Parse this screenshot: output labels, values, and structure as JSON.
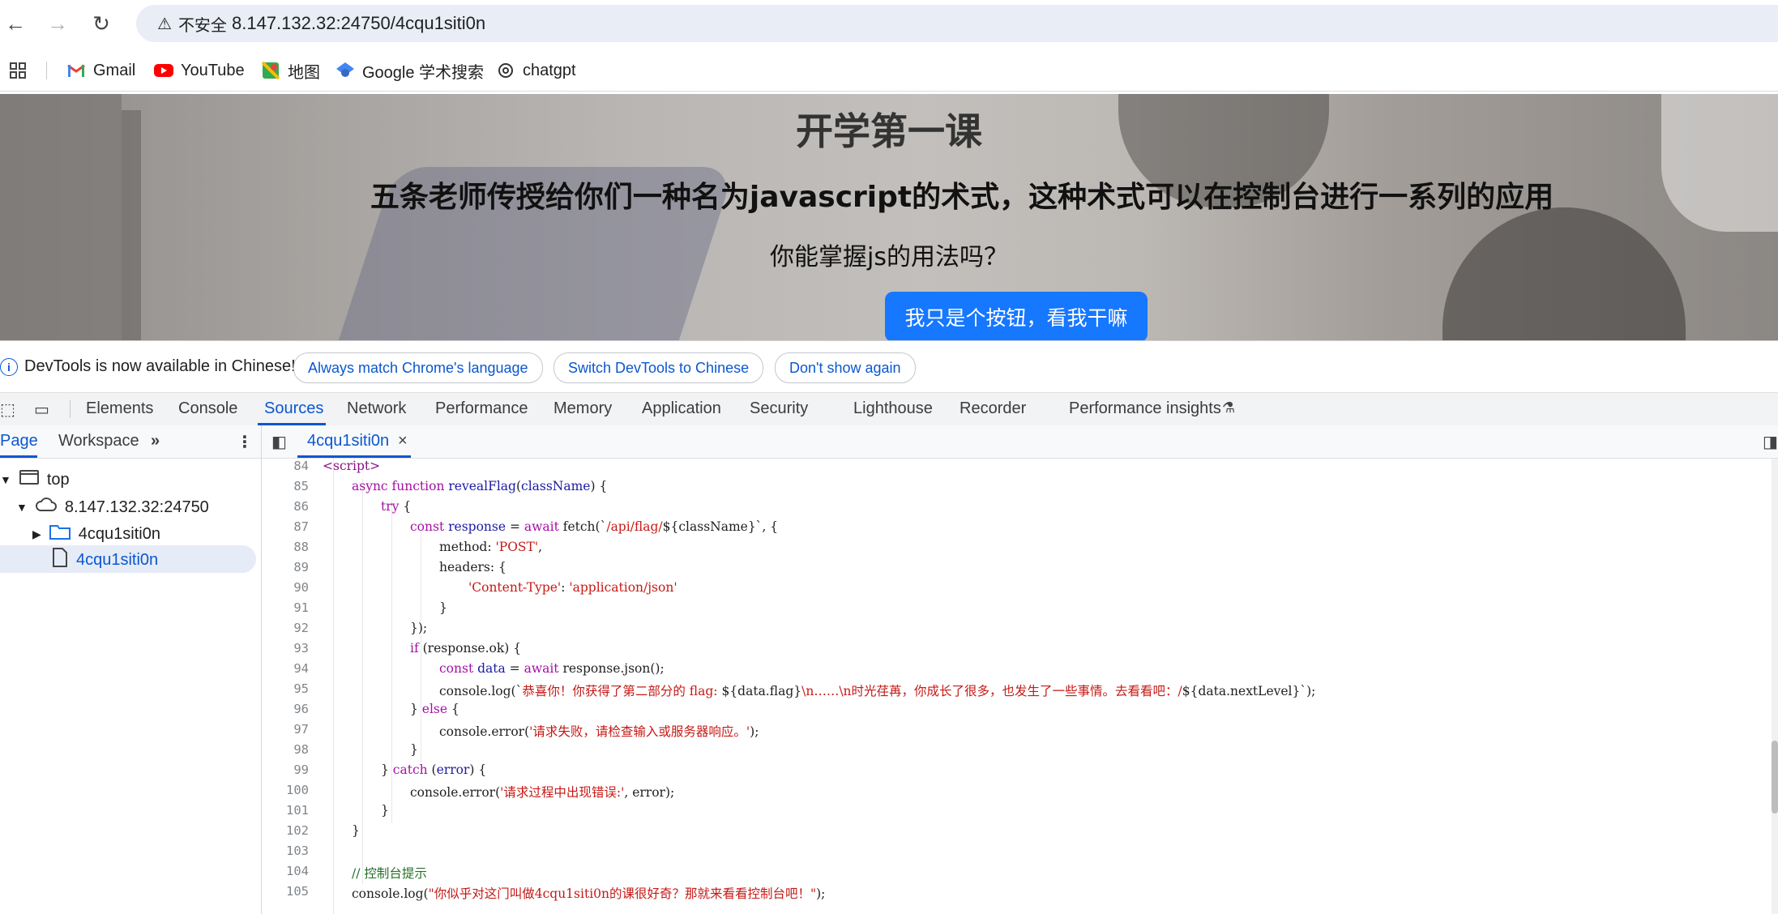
{
  "browser": {
    "security_label": "不安全",
    "url": "8.147.132.32:24750/4cqu1siti0n",
    "bookmarks": [
      {
        "label": "Gmail",
        "icon": "gmail-icon"
      },
      {
        "label": "YouTube",
        "icon": "youtube-icon"
      },
      {
        "label": "地图",
        "icon": "maps-icon"
      },
      {
        "label": "Google 学术搜索",
        "icon": "scholar-icon"
      },
      {
        "label": "chatgpt",
        "icon": "chatgpt-icon"
      }
    ]
  },
  "page": {
    "title": "开学第一课",
    "subtitle": "五条老师传授给你们一种名为javascript的术式，这种术式可以在控制台进行一系列的应用",
    "question": "你能掌握js的用法吗？",
    "button_label": "我只是个按钮，看我干嘛"
  },
  "devtools": {
    "infobar": {
      "text": "DevTools is now available in Chinese!",
      "btn_match": "Always match Chrome's language",
      "btn_switch": "Switch DevTools to Chinese",
      "btn_dismiss": "Don't show again"
    },
    "tabs": [
      "Elements",
      "Console",
      "Sources",
      "Network",
      "Performance",
      "Memory",
      "Application",
      "Security",
      "Lighthouse",
      "Recorder",
      "Performance insights"
    ],
    "active_tab": "Sources",
    "navigator": {
      "tabs": [
        "Page",
        "Workspace"
      ],
      "tree": {
        "top": "top",
        "host": "8.147.132.32:24750",
        "folder": "4cqu1siti0n",
        "file": "4cqu1siti0n"
      }
    },
    "editor_tab": "4cqu1siti0n",
    "line_numbers": [
      "84",
      "85",
      "86",
      "87",
      "88",
      "89",
      "90",
      "91",
      "92",
      "93",
      "94",
      "95",
      "96",
      "97",
      "98",
      "99",
      "100",
      "101",
      "102",
      "103",
      "104",
      "105"
    ]
  },
  "colors": {
    "accent": "#0b57d0",
    "page_button": "#1677ff",
    "keyword": "#a311a3",
    "string": "#c41a16",
    "comment": "#236e25"
  }
}
